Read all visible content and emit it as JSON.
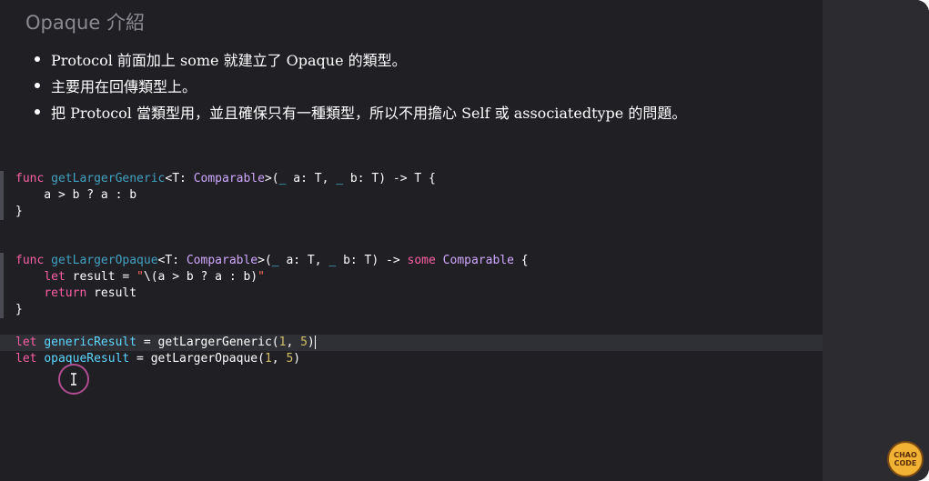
{
  "slide": {
    "title": "Opaque 介紹",
    "bullets": [
      "Protocol 前面加上 some 就建立了 Opaque 的類型。",
      "主要用在回傳類型上。",
      "把 Protocol 當類型用，並且確保只有一種類型，所以不用擔心 Self 或 associatedtype 的問題。"
    ]
  },
  "code": {
    "lines": [
      [],
      [
        {
          "t": "func",
          "c": "kw"
        },
        {
          "t": " ",
          "c": "plain"
        },
        {
          "t": "getLargerGeneric",
          "c": "fn-decl"
        },
        {
          "t": "<T: ",
          "c": "plain"
        },
        {
          "t": "Comparable",
          "c": "type"
        },
        {
          "t": ">(",
          "c": "plain"
        },
        {
          "t": "_",
          "c": "param"
        },
        {
          "t": " a: T, ",
          "c": "plain"
        },
        {
          "t": "_",
          "c": "param"
        },
        {
          "t": " b: T) -> T {",
          "c": "plain"
        }
      ],
      [
        {
          "t": "    a > b ? a : b",
          "c": "plain"
        }
      ],
      [
        {
          "t": "}",
          "c": "plain"
        }
      ],
      [],
      [],
      [
        {
          "t": "func",
          "c": "kw"
        },
        {
          "t": " ",
          "c": "plain"
        },
        {
          "t": "getLargerOpaque",
          "c": "fn-decl"
        },
        {
          "t": "<T: ",
          "c": "plain"
        },
        {
          "t": "Comparable",
          "c": "type"
        },
        {
          "t": ">(",
          "c": "plain"
        },
        {
          "t": "_",
          "c": "param"
        },
        {
          "t": " a: T, ",
          "c": "plain"
        },
        {
          "t": "_",
          "c": "param"
        },
        {
          "t": " b: T) -> ",
          "c": "plain"
        },
        {
          "t": "some",
          "c": "kw"
        },
        {
          "t": " ",
          "c": "plain"
        },
        {
          "t": "Comparable",
          "c": "type"
        },
        {
          "t": " {",
          "c": "plain"
        }
      ],
      [
        {
          "t": "    ",
          "c": "plain"
        },
        {
          "t": "let",
          "c": "kw"
        },
        {
          "t": " result = ",
          "c": "plain"
        },
        {
          "t": "\"",
          "c": "str"
        },
        {
          "t": "\\(a > b ? a : b)",
          "c": "plain"
        },
        {
          "t": "\"",
          "c": "str"
        }
      ],
      [
        {
          "t": "    ",
          "c": "plain"
        },
        {
          "t": "return",
          "c": "kw"
        },
        {
          "t": " result",
          "c": "plain"
        }
      ],
      [
        {
          "t": "}",
          "c": "plain"
        }
      ],
      [],
      [
        {
          "t": "let",
          "c": "kw"
        },
        {
          "t": " ",
          "c": "plain"
        },
        {
          "t": "genericResult",
          "c": "param"
        },
        {
          "t": " = ",
          "c": "plain"
        },
        {
          "t": "getLargerGeneric",
          "c": "plain"
        },
        {
          "t": "(",
          "c": "plain"
        },
        {
          "t": "1",
          "c": "num"
        },
        {
          "t": ", ",
          "c": "plain"
        },
        {
          "t": "5",
          "c": "num"
        },
        {
          "t": ")",
          "c": "plain"
        }
      ],
      [
        {
          "t": "let",
          "c": "kw"
        },
        {
          "t": " ",
          "c": "plain"
        },
        {
          "t": "opaqueResult",
          "c": "param"
        },
        {
          "t": " = ",
          "c": "plain"
        },
        {
          "t": "getLargerOpaque",
          "c": "plain"
        },
        {
          "t": "(",
          "c": "plain"
        },
        {
          "t": "1",
          "c": "num"
        },
        {
          "t": ", ",
          "c": "plain"
        },
        {
          "t": "5",
          "c": "num"
        },
        {
          "t": ")",
          "c": "plain"
        }
      ]
    ],
    "folded_lines": [
      1,
      2,
      3,
      6,
      7,
      8,
      9
    ],
    "current_line": 11
  },
  "logo": {
    "line1": "CHAO",
    "line2": "CODE"
  },
  "colors": {
    "background": "#1f1f24",
    "side_panel": "#2b2b30",
    "keyword": "#fc5fa3",
    "type": "#d0a8ff",
    "function_declaration": "#41a1c0",
    "parameter": "#5dd8ff",
    "string": "#fc6a5d",
    "number": "#d0bf69",
    "logo": "#f2b234"
  },
  "icons": {
    "cursor": "i-beam-cursor-icon"
  }
}
